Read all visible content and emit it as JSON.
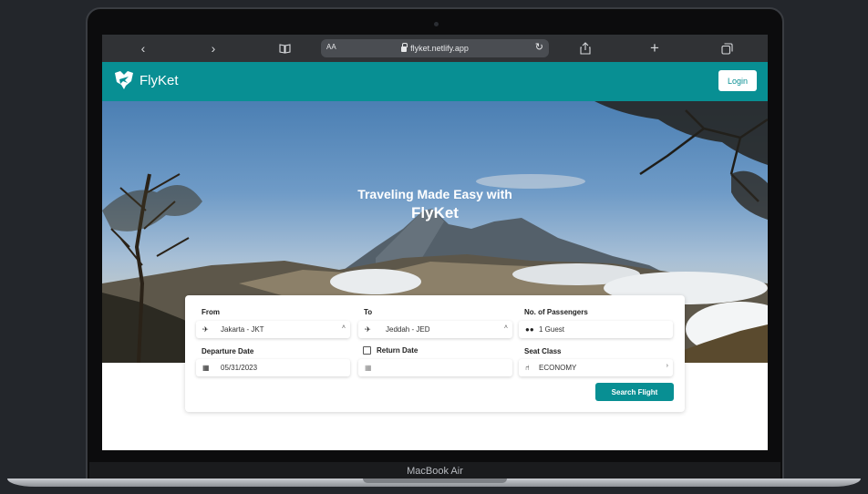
{
  "device": {
    "label": "MacBook Air"
  },
  "browser": {
    "url": "flyket.netlify.app",
    "reader_label": "AA",
    "icons": [
      "back-icon",
      "forward-icon",
      "bookmarks-icon",
      "lock-icon",
      "reload-icon",
      "share-icon",
      "new-tab-icon",
      "tabs-icon"
    ]
  },
  "header": {
    "brand": "FlyKet",
    "login_label": "Login",
    "accent_color": "#088f93"
  },
  "hero": {
    "title": "Traveling Made Easy with",
    "brand": "FlyKet"
  },
  "search": {
    "from": {
      "label": "From",
      "value": "Jakarta - JKT"
    },
    "to": {
      "label": "To",
      "value": "Jeddah - JED"
    },
    "passengers": {
      "label": "No. of Passengers",
      "value": "1 Guest"
    },
    "departure": {
      "label": "Departure Date",
      "value": "05/31/2023"
    },
    "return": {
      "label": "Return Date",
      "value": "",
      "checked": false
    },
    "seat_class": {
      "label": "Seat Class",
      "value": "ECONOMY"
    },
    "button_label": "Search Flight"
  }
}
